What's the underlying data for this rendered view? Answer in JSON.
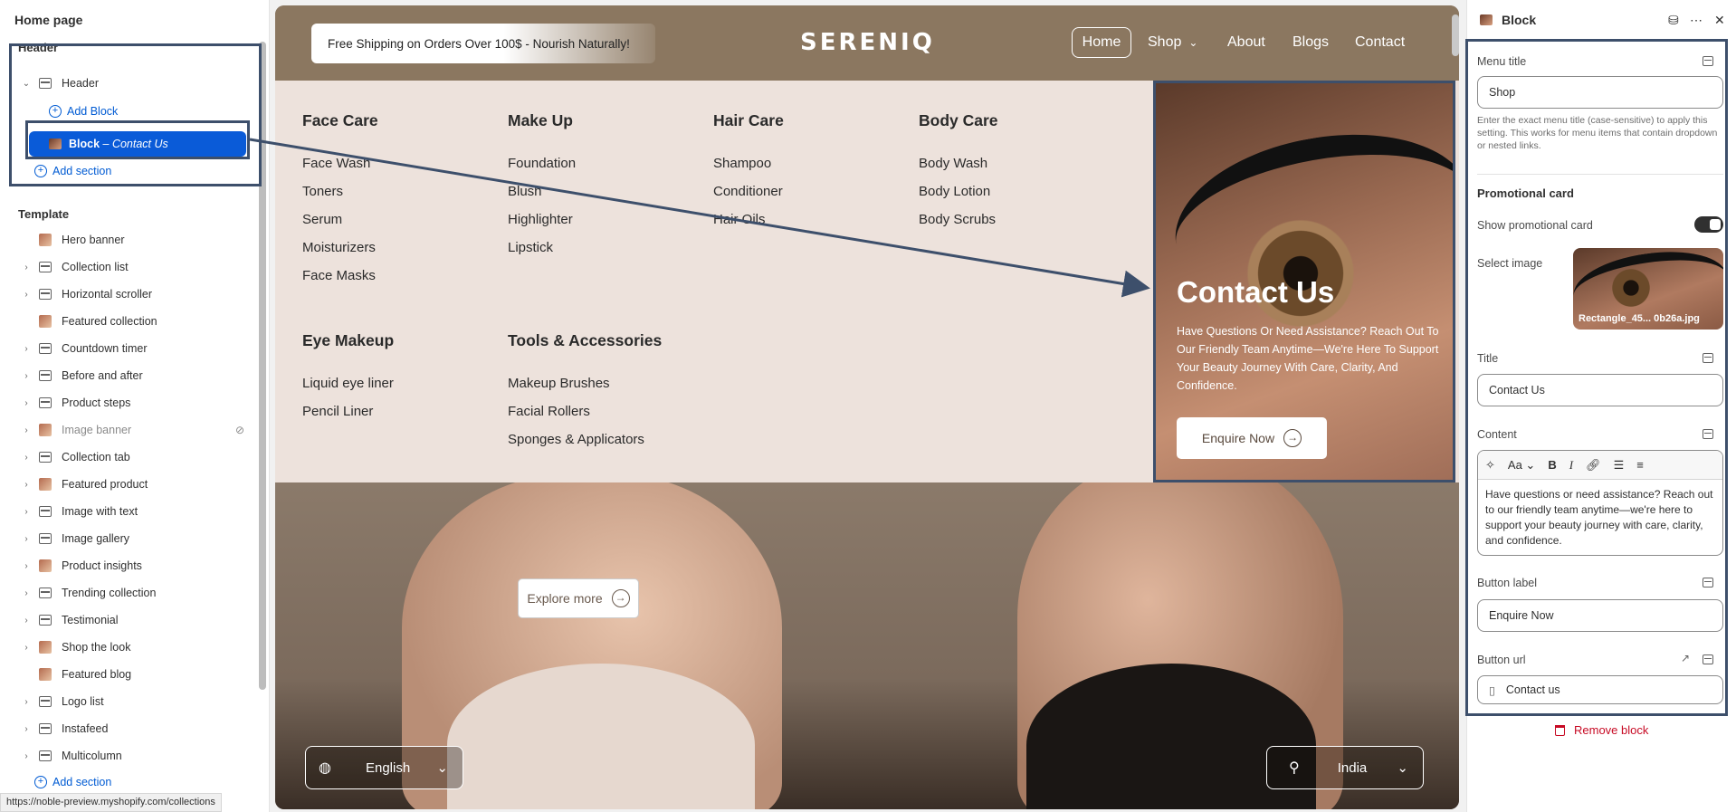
{
  "left_panel": {
    "title": "Home page",
    "header_section": {
      "label": "Header",
      "item": "Header",
      "add_block": "Add Block",
      "selected_block": {
        "name": "Block",
        "suffix": "– Contact Us"
      },
      "add_section": "Add section"
    },
    "template_section": {
      "label": "Template",
      "items": [
        {
          "label": "Hero banner",
          "icon": "image-thumb",
          "expandable": false
        },
        {
          "label": "Collection list",
          "icon": "section-icon",
          "expandable": true
        },
        {
          "label": "Horizontal scroller",
          "icon": "section-icon",
          "expandable": true
        },
        {
          "label": "Featured collection",
          "icon": "image-thumb",
          "expandable": false
        },
        {
          "label": "Countdown timer",
          "icon": "section-icon",
          "expandable": true
        },
        {
          "label": "Before and after",
          "icon": "section-icon",
          "expandable": true
        },
        {
          "label": "Product steps",
          "icon": "section-icon",
          "expandable": true
        },
        {
          "label": "Image banner",
          "icon": "image-thumb",
          "expandable": true,
          "hidden": true
        },
        {
          "label": "Collection tab",
          "icon": "section-icon",
          "expandable": true
        },
        {
          "label": "Featured product",
          "icon": "image-thumb",
          "expandable": true
        },
        {
          "label": "Image with text",
          "icon": "section-icon",
          "expandable": true
        },
        {
          "label": "Image gallery",
          "icon": "section-icon",
          "expandable": true
        },
        {
          "label": "Product insights",
          "icon": "image-thumb",
          "expandable": true
        },
        {
          "label": "Trending collection",
          "icon": "section-icon",
          "expandable": true
        },
        {
          "label": "Testimonial",
          "icon": "section-icon",
          "expandable": true
        },
        {
          "label": "Shop the look",
          "icon": "image-thumb",
          "expandable": true
        },
        {
          "label": "Featured blog",
          "icon": "image-thumb",
          "expandable": false
        },
        {
          "label": "Logo list",
          "icon": "section-icon",
          "expandable": true
        },
        {
          "label": "Instafeed",
          "icon": "section-icon",
          "expandable": true
        },
        {
          "label": "Multicolumn",
          "icon": "section-icon",
          "expandable": true
        }
      ],
      "add_section": "Add section"
    },
    "status_url": "https://noble-preview.myshopify.com/collections"
  },
  "preview": {
    "shipping_text": "Free Shipping on Orders Over 100$ - Nourish Naturally!",
    "logo": "SERENIQ",
    "nav": [
      "Home",
      "Shop",
      "About",
      "Blogs",
      "Contact"
    ],
    "active_nav": "Home",
    "menu_columns": [
      {
        "heading": "Face Care",
        "items": [
          "Face Wash",
          "Toners",
          "Serum",
          "Moisturizers",
          "Face Masks"
        ]
      },
      {
        "heading": "Make Up",
        "items": [
          "Foundation",
          "Blush",
          "Highlighter",
          "Lipstick"
        ]
      },
      {
        "heading": "Hair Care",
        "items": [
          "Shampoo",
          "Conditioner",
          "Hair Oils"
        ]
      },
      {
        "heading": "Body Care",
        "items": [
          "Body Wash",
          "Body Lotion",
          "Body Scrubs"
        ]
      },
      {
        "heading": "Eye Makeup",
        "items": [
          "Liquid eye liner",
          "Pencil Liner"
        ]
      },
      {
        "heading": "Tools & Accessories",
        "items": [
          "Makeup Brushes",
          "Facial Rollers",
          "Sponges & Applicators"
        ]
      }
    ],
    "promo": {
      "title": "Contact Us",
      "text": "Have Questions Or Need Assistance? Reach Out To Our Friendly Team Anytime—We're Here To Support Your Beauty Journey With Care, Clarity, And Confidence.",
      "button": "Enquire Now"
    },
    "explore_button": "Explore more",
    "language": "English",
    "country": "India"
  },
  "right_panel": {
    "title": "Block",
    "menu_title_label": "Menu title",
    "menu_title_value": "Shop",
    "help_text": "Enter the exact menu title (case-sensitive) to apply this setting. This works for menu items that contain dropdown or nested links.",
    "promo_heading": "Promotional card",
    "show_promo_label": "Show promotional card",
    "show_promo_value": true,
    "select_image_label": "Select image",
    "image_name": "Rectangle_45... 0b26a.jpg",
    "title_label": "Title",
    "title_value": "Contact Us",
    "content_label": "Content",
    "content_value": "Have questions or need assistance? Reach out to our friendly team anytime—we're here to support your beauty journey with care, clarity, and confidence.",
    "button_label_label": "Button label",
    "button_label_value": "Enquire Now",
    "button_url_label": "Button url",
    "button_url_value": "Contact us",
    "remove_block": "Remove block"
  },
  "colors": {
    "accent": "#0a5bd8",
    "link": "#005bd3",
    "danger": "#c70a24",
    "header_bg": "#8b7760",
    "mega_bg": "#ede2dc",
    "annotation": "#3d4f6b"
  }
}
